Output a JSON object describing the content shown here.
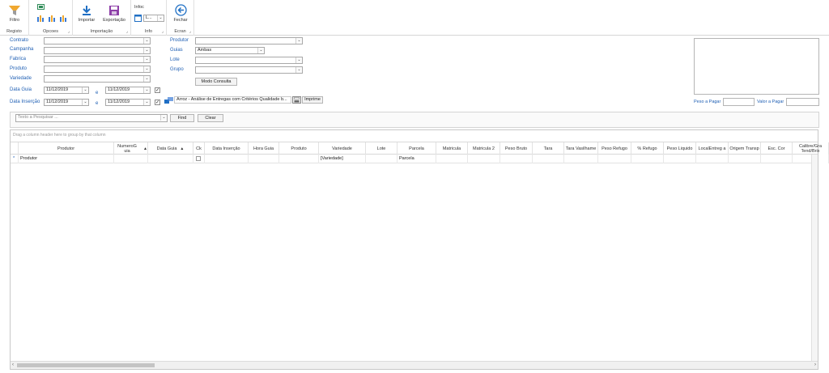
{
  "ribbon": {
    "registo": {
      "button": "Filtro",
      "caption": "Registo"
    },
    "opcoes": {
      "caption": "Opcoes"
    },
    "importacao": {
      "import": "Importar",
      "export": "Exportação",
      "caption": "Importação"
    },
    "info": {
      "title": "Infoc",
      "combo": "L...",
      "caption": "Info"
    },
    "ecran": {
      "button": "Fechar",
      "caption": "Ecran"
    }
  },
  "filters": {
    "contrato": "Contrato",
    "campanha": "Campanha",
    "fabrica": "Fabrica",
    "produto": "Produto",
    "variedade": "Variedade",
    "data_guia": "Data Guia",
    "data_insercao": "Data Inserção",
    "produtor": "Produtor",
    "guias": "Guias",
    "guias_value": "Ambas",
    "lote": "Lote",
    "grupo": "Grupo",
    "modo_consulta": "Modo Consulta",
    "date_from_1": "11/12/2019",
    "date_to_1": "11/12/2019",
    "date_from_2": "11/12/2019",
    "date_to_2": "11/12/2019",
    "e1": "e",
    "e2": "e",
    "report": "Arroz - Análise de Entregas com Critérios Qualidade b...",
    "imprime": "Imprime",
    "peso_pagar": "Peso a Pagar",
    "valor_pagar": "Valor a Pagar"
  },
  "search": {
    "placeholder": "Texto a Pesquisar ...",
    "find": "Find",
    "clear": "Clear"
  },
  "grid": {
    "group_hint": "Drag a column header here to group by that column",
    "columns": [
      "Produtor",
      "NumeroG uia",
      "Data Guia",
      "Ck",
      "Data Inserção",
      "Hora Guia",
      "Produto",
      "Variedade",
      "Lote",
      "Parcela",
      "Matricula",
      "Matricula 2",
      "Peso Bruto",
      "Tara",
      "Tara Vasilhame",
      "Peso Refugo",
      "% Refugo",
      "Peso Liquido",
      "LocalEntreg a",
      "Origem Transp",
      "Esc. Cor",
      "Calibre/Gra Tend/Brix"
    ],
    "filter_row": [
      "Produtor",
      "",
      "",
      "",
      "",
      "",
      "",
      "[Variedade]",
      "",
      "Parcela",
      "",
      "",
      "",
      "",
      "",
      "",
      "",
      "",
      "",
      "",
      "",
      ""
    ],
    "row_marker": "*"
  }
}
